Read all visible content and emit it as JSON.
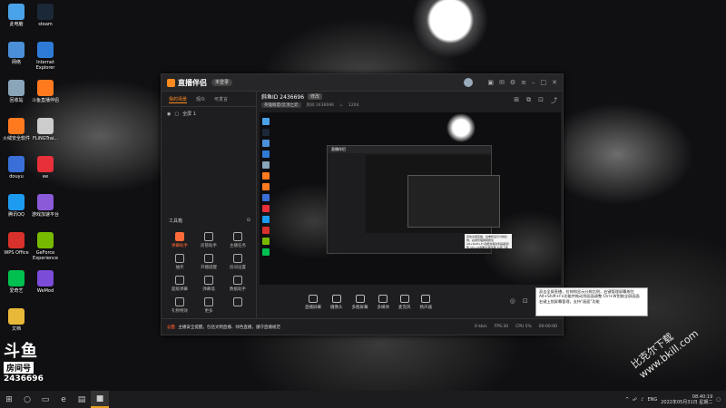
{
  "desktop_icons": [
    {
      "label": "此电脑",
      "color": "#4aa3e8"
    },
    {
      "label": "steam",
      "color": "#1b2838"
    },
    {
      "label": "网络",
      "color": "#4a8fd8"
    },
    {
      "label": "Internet Explorer",
      "color": "#2e7bd6"
    },
    {
      "label": "回收站",
      "color": "#8aa4b8"
    },
    {
      "label": "斗鱼直播伴侣",
      "color": "#ff7a1f"
    },
    {
      "label": "火绒安全软件",
      "color": "#ff7a1f"
    },
    {
      "label": "FLiNGTrai...",
      "color": "#ccc"
    },
    {
      "label": "douyu",
      "color": "#3a6fd8"
    },
    {
      "label": "ee",
      "color": "#e8303a"
    },
    {
      "label": "腾讯QQ",
      "color": "#1d9bf0"
    },
    {
      "label": "游戏加速平台",
      "color": "#8a5ad8"
    },
    {
      "label": "WPS Office",
      "color": "#d8302a"
    },
    {
      "label": "GeForce Experience",
      "color": "#76b900"
    },
    {
      "label": "爱奇艺",
      "color": "#00c050"
    },
    {
      "label": "WeMod",
      "color": "#7a4cd8"
    },
    {
      "label": "文档",
      "color": "#e8b838"
    }
  ],
  "overlay": {
    "logo_text": "斗鱼",
    "room_label": "房间号",
    "room_number": "2436696",
    "watermark": "比克尔下载 www.bkill.com"
  },
  "app": {
    "name": "直播伴侣",
    "login": "未登录",
    "tabs": [
      "我的场景",
      "观众",
      "可发言"
    ],
    "scene_name": "全屏 1",
    "room_title": "斜鱼ID 2436696",
    "edit_label": "修改",
    "room_category": "英雄联盟/云顶之弈",
    "room_sub_id": "房间 2436696",
    "room_heat": "1204",
    "tools_label": "工具箱",
    "tools": [
      {
        "label": "弹幕助手",
        "active": true
      },
      {
        "label": "房管助手",
        "active": false
      },
      {
        "label": "主播任务",
        "active": false
      },
      {
        "label": "抽奖",
        "active": false
      },
      {
        "label": "开播提醒",
        "active": false
      },
      {
        "label": "房间设置",
        "active": false
      },
      {
        "label": "超级弹幕",
        "active": false
      },
      {
        "label": "弹幕墙",
        "active": false
      },
      {
        "label": "数据助手",
        "active": false
      },
      {
        "label": "礼物特效",
        "active": false
      },
      {
        "label": "更多",
        "active": false
      },
      {
        "label": "",
        "active": false
      }
    ],
    "controls": [
      "直播屏幕",
      "摄像头",
      "多图屏幕",
      "多媒体",
      "麦克风",
      "扬声器"
    ],
    "notice_prefix": "公告",
    "notice": "主播安全提醒，包括文明直播、绿色直播，遵守直播规范",
    "stats": [
      "0 kb/s",
      "FPS:30",
      "CPU 5%",
      "00:00:00"
    ]
  },
  "tooltip_text": "双击全屏直播，拉伸和显示分辨比例，右键管理屏幕按住Alt+Shift+Fn功能并拖动到画面调整 Ctrl+W钳制全屏画面 右键上锁屏幕管理，支持\"画面\"功能",
  "taskbar": {
    "tray_lang": "ENG",
    "time": "08:40:19",
    "date": "2022年05月31日 星期二"
  }
}
